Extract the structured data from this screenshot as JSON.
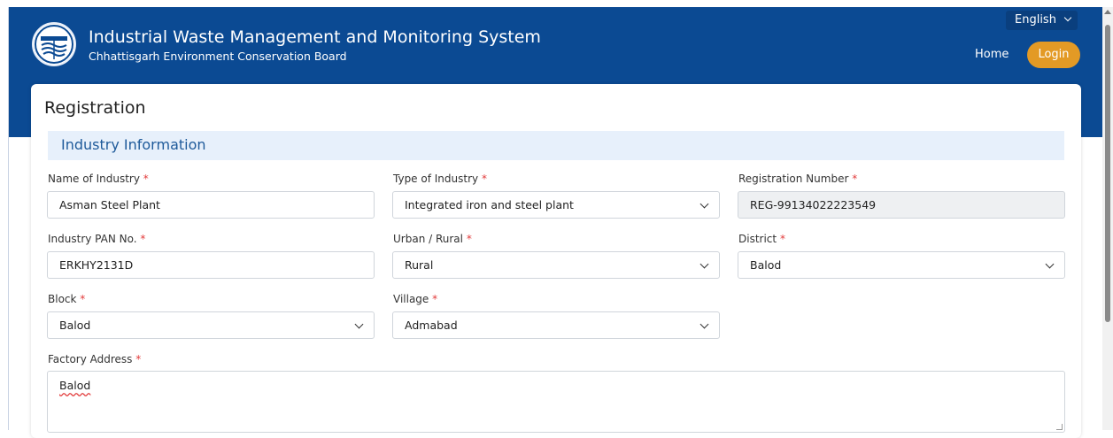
{
  "header": {
    "title": "Industrial Waste Management and Monitoring System",
    "subtitle": "Chhattisgarh Environment Conservation Board",
    "language": "English",
    "home_label": "Home",
    "login_label": "Login",
    "logo_icon": "cecb-emblem-icon",
    "brand_color": "#0b4a93",
    "accent_color": "#e39a25"
  },
  "page": {
    "title": "Registration",
    "section_title": "Industry Information"
  },
  "form": {
    "name_of_industry": {
      "label": "Name of Industry",
      "value": "Asman Steel Plant"
    },
    "type_of_industry": {
      "label": "Type of Industry",
      "value": "Integrated iron and steel plant"
    },
    "registration_number": {
      "label": "Registration Number",
      "value": "REG-99134022223549"
    },
    "pan": {
      "label": "Industry PAN No.",
      "value": "ERKHY2131D"
    },
    "urban_rural": {
      "label": "Urban / Rural",
      "value": "Rural"
    },
    "district": {
      "label": "District",
      "value": "Balod"
    },
    "block": {
      "label": "Block",
      "value": "Balod"
    },
    "village": {
      "label": "Village",
      "value": "Admabad"
    },
    "factory_address": {
      "label": "Factory Address",
      "value": "Balod"
    },
    "required_mark": "*"
  }
}
